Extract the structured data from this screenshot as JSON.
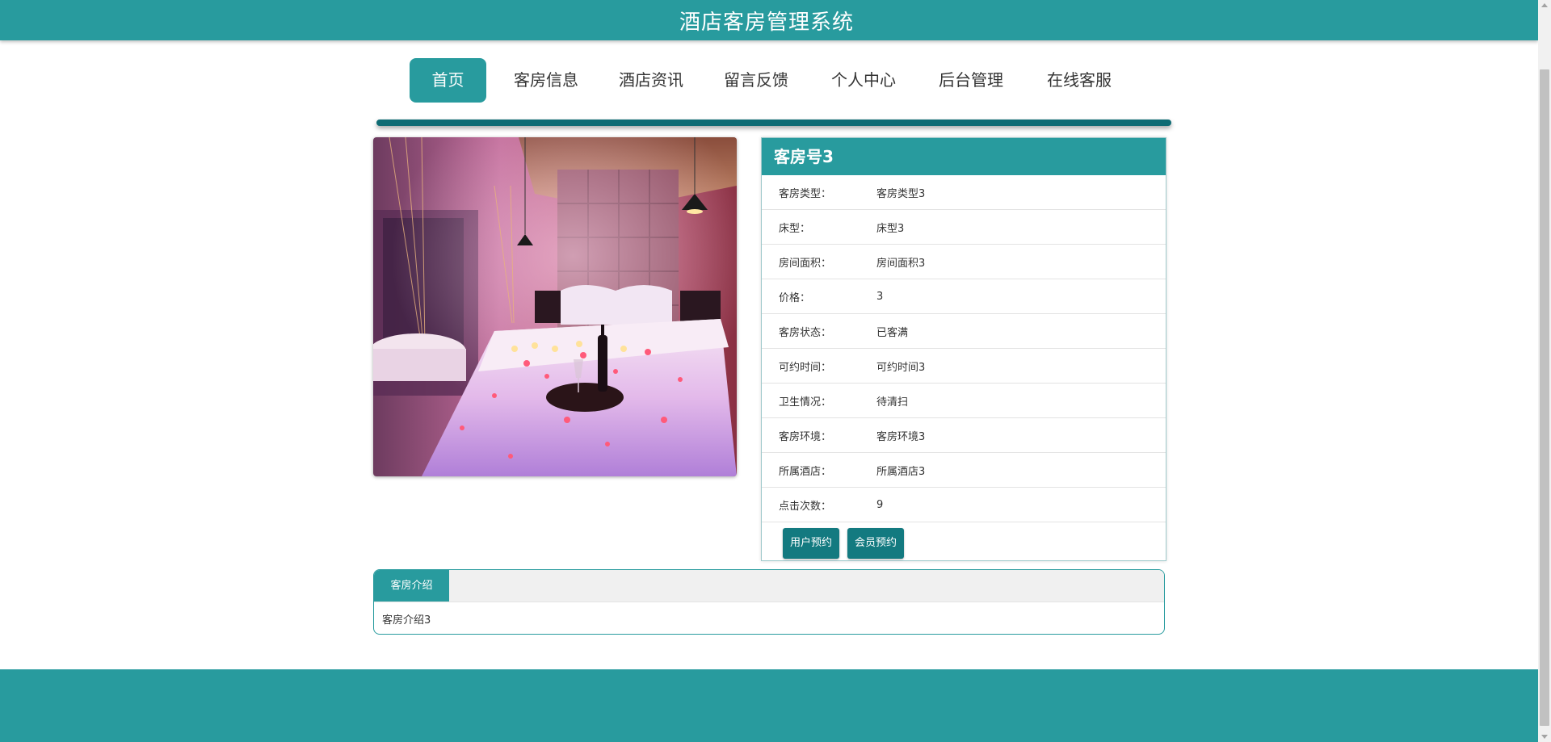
{
  "header": {
    "title": "酒店客房管理系统"
  },
  "nav": {
    "items": [
      {
        "label": "首页"
      },
      {
        "label": "客房信息"
      },
      {
        "label": "酒店资讯"
      },
      {
        "label": "留言反馈"
      },
      {
        "label": "个人中心"
      },
      {
        "label": "后台管理"
      },
      {
        "label": "在线客服"
      }
    ],
    "active": "首页"
  },
  "room": {
    "title": "客房号3",
    "image": {
      "icon": "room-photo",
      "description_colors": [
        "#c15a8c",
        "#f3e9f7"
      ]
    },
    "fields": [
      {
        "label": "客房类型：",
        "value": "客房类型3"
      },
      {
        "label": "床型：",
        "value": "床型3"
      },
      {
        "label": "房间面积：",
        "value": "房间面积3"
      },
      {
        "label": "价格：",
        "value": "3"
      },
      {
        "label": "客房状态：",
        "value": "已客满"
      },
      {
        "label": "可约时间：",
        "value": "可约时间3"
      },
      {
        "label": "卫生情况：",
        "value": "待清扫"
      },
      {
        "label": "客房环境：",
        "value": "客房环境3"
      },
      {
        "label": "所属酒店：",
        "value": "所属酒店3"
      },
      {
        "label": "点击次数：",
        "value": "9"
      }
    ],
    "actions": [
      {
        "label": "用户预约"
      },
      {
        "label": "会员预约"
      }
    ]
  },
  "intro": {
    "tab_label": "客房介绍",
    "content": "客房介绍3"
  },
  "colors": {
    "primary": "#289b9e",
    "button": "#137a80",
    "divider": "#0f6c74"
  }
}
